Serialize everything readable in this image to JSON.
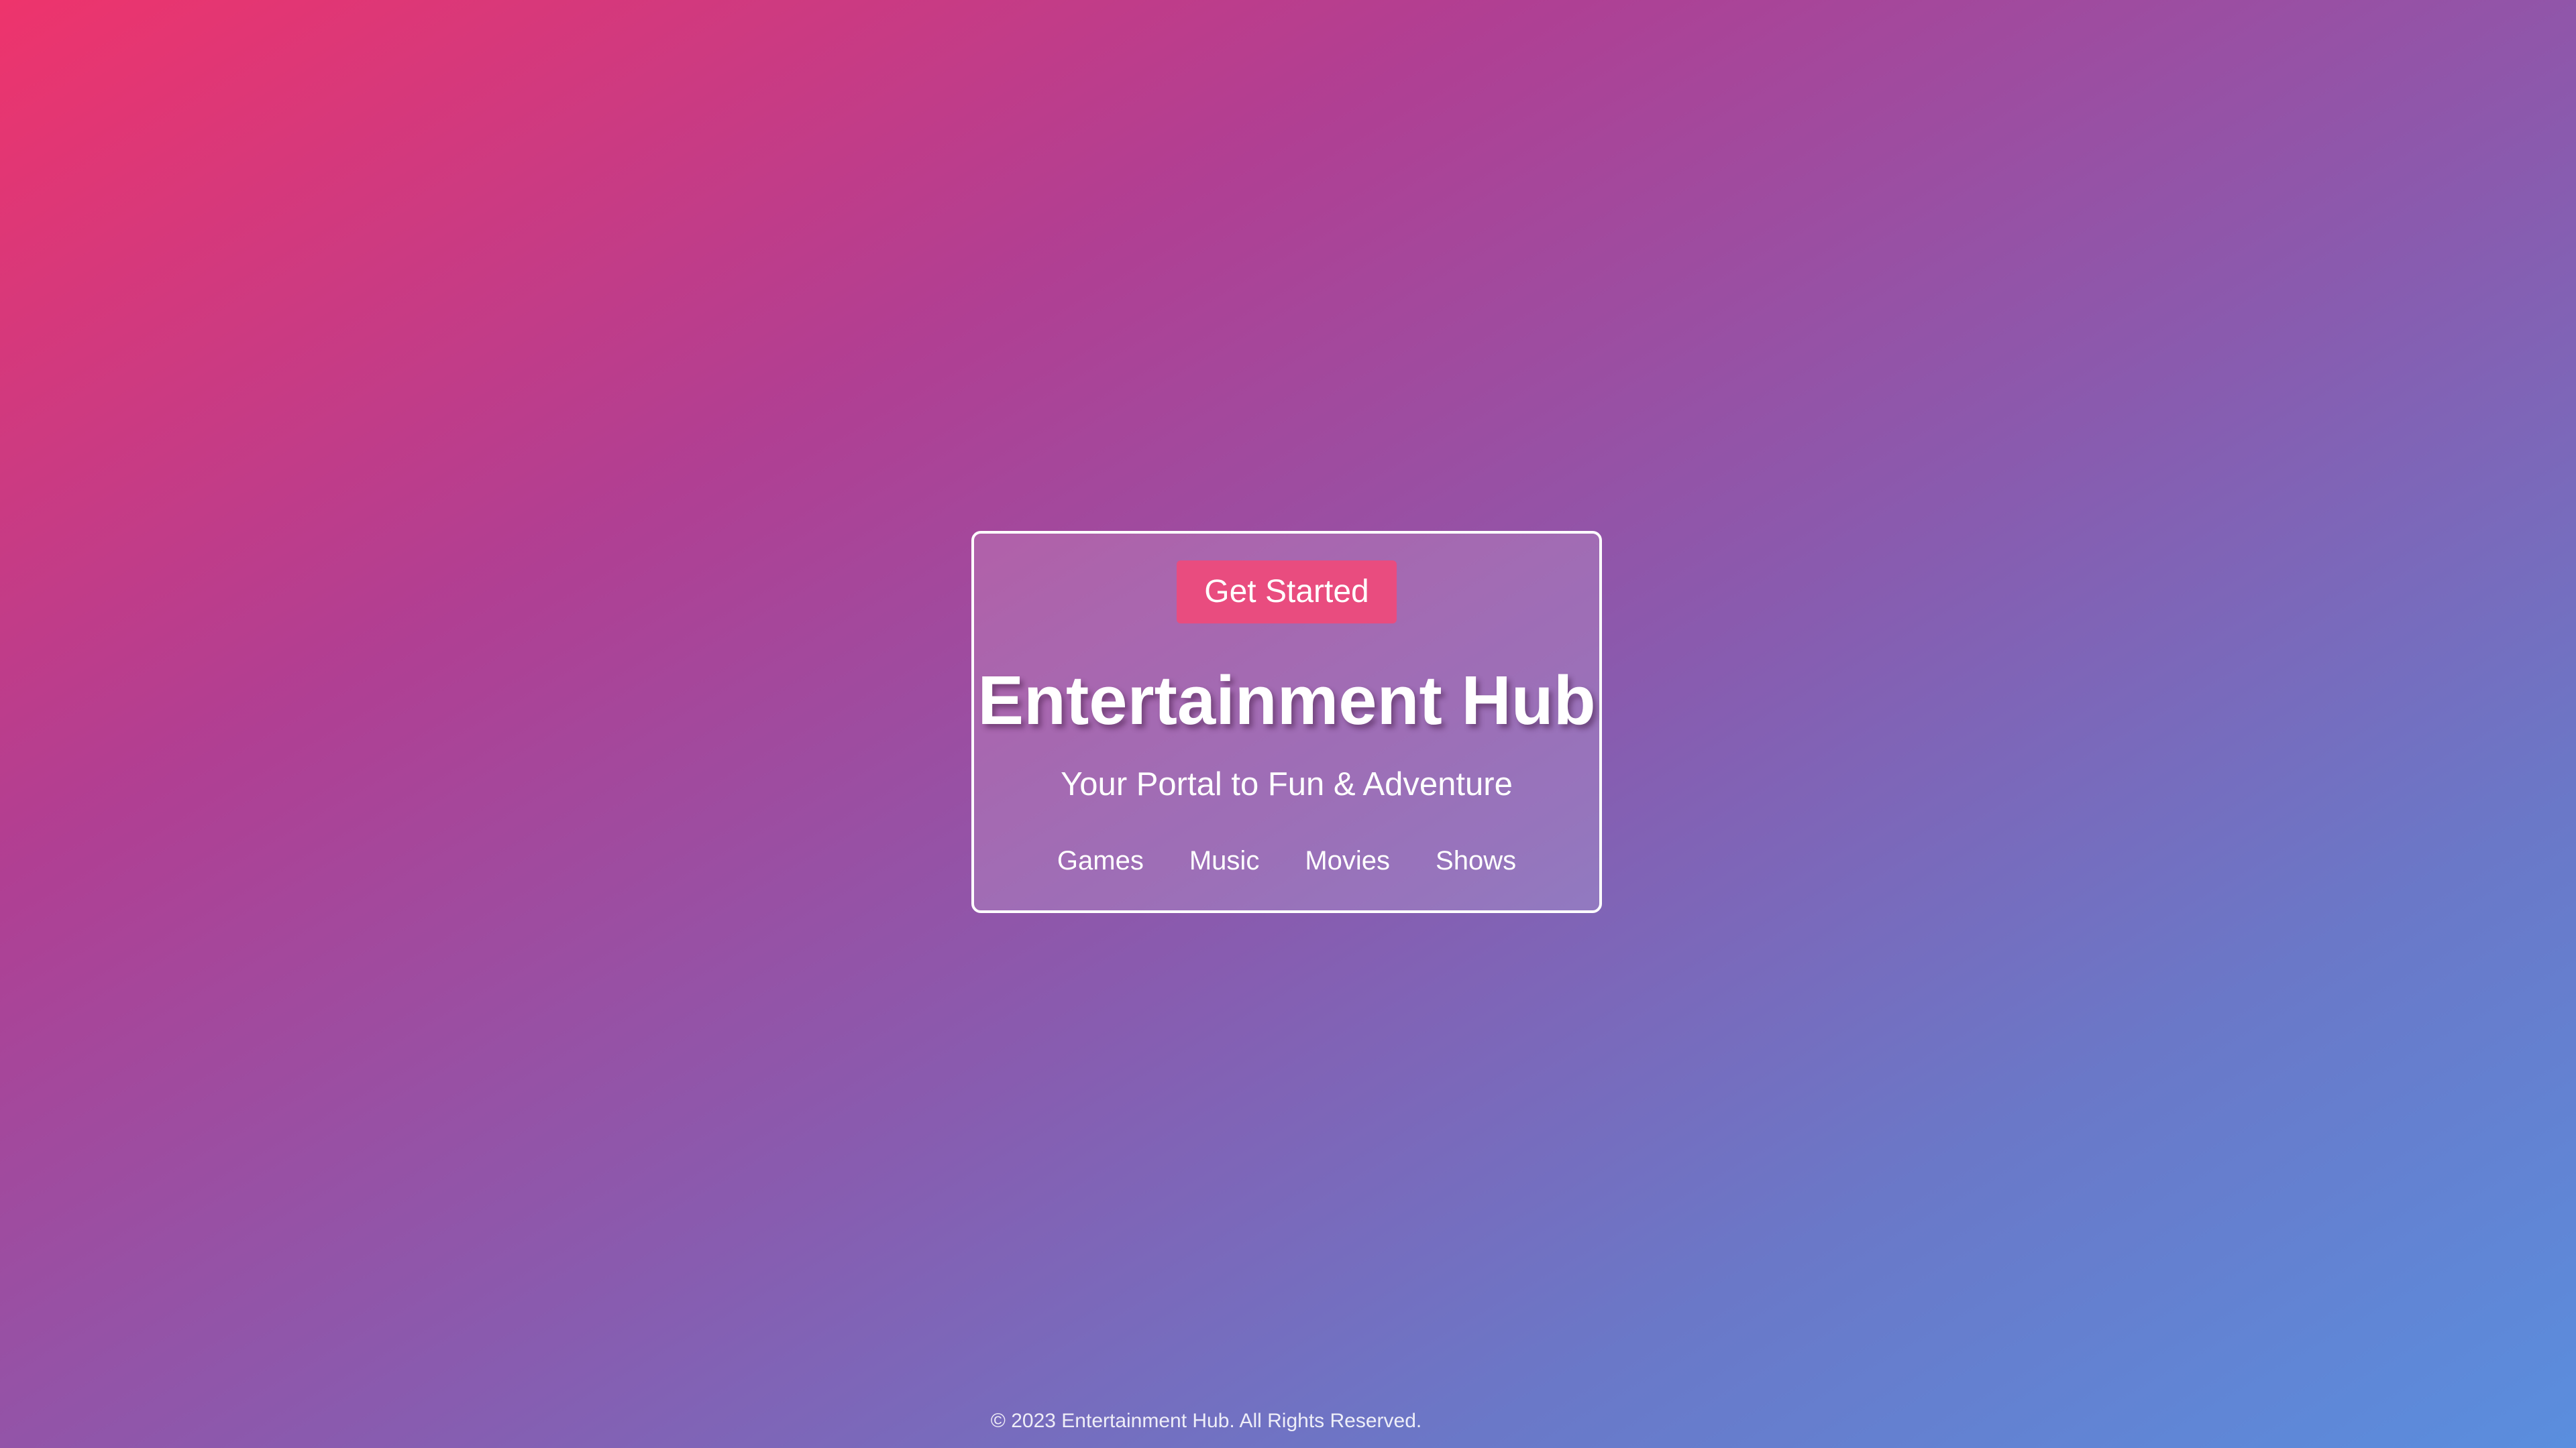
{
  "hero": {
    "cta_label": "Get Started",
    "title": "Entertainment Hub",
    "tagline": "Your Portal to Fun & Adventure"
  },
  "nav": {
    "items": [
      {
        "label": "Games"
      },
      {
        "label": "Music"
      },
      {
        "label": "Movies"
      },
      {
        "label": "Shows"
      }
    ]
  },
  "footer": {
    "text": "© 2023 Entertainment Hub. All Rights Reserved."
  },
  "colors": {
    "cta_background": "#e94c7f",
    "gradient_start": "#ee346c",
    "gradient_end": "#5a8ede",
    "text": "#ffffff"
  }
}
